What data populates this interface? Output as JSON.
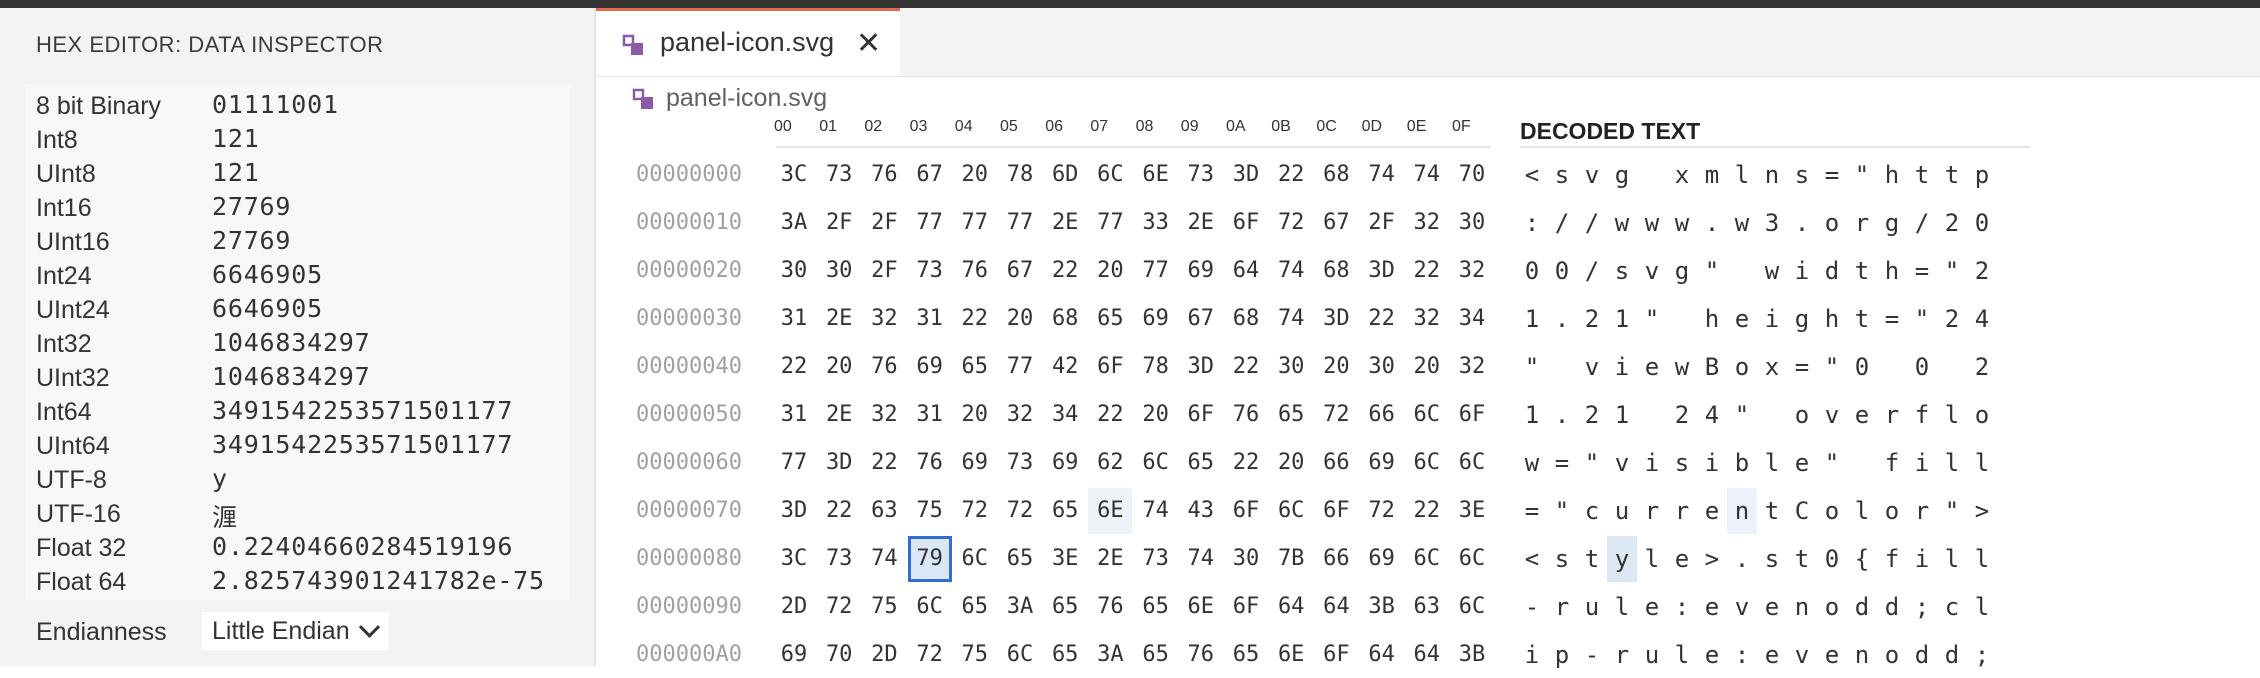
{
  "sidebar": {
    "title": "HEX EDITOR: DATA INSPECTOR",
    "rows": [
      {
        "label": "8 bit Binary",
        "value": "01111001"
      },
      {
        "label": "Int8",
        "value": "121"
      },
      {
        "label": "UInt8",
        "value": "121"
      },
      {
        "label": "Int16",
        "value": "27769"
      },
      {
        "label": "UInt16",
        "value": "27769"
      },
      {
        "label": "Int24",
        "value": "6646905"
      },
      {
        "label": "UInt24",
        "value": "6646905"
      },
      {
        "label": "Int32",
        "value": "1046834297"
      },
      {
        "label": "UInt32",
        "value": "1046834297"
      },
      {
        "label": "Int64",
        "value": "3491542253571501177"
      },
      {
        "label": "UInt64",
        "value": "3491542253571501177"
      },
      {
        "label": "UTF-8",
        "value": "y"
      },
      {
        "label": "UTF-16",
        "value": "湹"
      },
      {
        "label": "Float 32",
        "value": "0.22404660284519196"
      },
      {
        "label": "Float 64",
        "value": "2.825743901241782e-75"
      }
    ],
    "endianness_label": "Endianness",
    "endianness_value": "Little Endian"
  },
  "tab": {
    "label": "panel-icon.svg",
    "close": "✕"
  },
  "breadcrumb": {
    "label": "panel-icon.svg"
  },
  "hex": {
    "header_bytes": [
      "00",
      "01",
      "02",
      "03",
      "04",
      "05",
      "06",
      "07",
      "08",
      "09",
      "0A",
      "0B",
      "0C",
      "0D",
      "0E",
      "0F"
    ],
    "decoded_header": "DECODED TEXT",
    "rows": [
      {
        "offset": "00000000",
        "bytes": [
          "3C",
          "73",
          "76",
          "67",
          "20",
          "78",
          "6D",
          "6C",
          "6E",
          "73",
          "3D",
          "22",
          "68",
          "74",
          "74",
          "70"
        ],
        "text": [
          "<",
          "s",
          "v",
          "g",
          " ",
          "x",
          "m",
          "l",
          "n",
          "s",
          "=",
          "\"",
          "h",
          "t",
          "t",
          "p"
        ]
      },
      {
        "offset": "00000010",
        "bytes": [
          "3A",
          "2F",
          "2F",
          "77",
          "77",
          "77",
          "2E",
          "77",
          "33",
          "2E",
          "6F",
          "72",
          "67",
          "2F",
          "32",
          "30"
        ],
        "text": [
          ":",
          "/",
          "/",
          "w",
          "w",
          "w",
          ".",
          "w",
          "3",
          ".",
          "o",
          "r",
          "g",
          "/",
          "2",
          "0"
        ]
      },
      {
        "offset": "00000020",
        "bytes": [
          "30",
          "30",
          "2F",
          "73",
          "76",
          "67",
          "22",
          "20",
          "77",
          "69",
          "64",
          "74",
          "68",
          "3D",
          "22",
          "32"
        ],
        "text": [
          "0",
          "0",
          "/",
          "s",
          "v",
          "g",
          "\"",
          " ",
          "w",
          "i",
          "d",
          "t",
          "h",
          "=",
          "\"",
          "2"
        ]
      },
      {
        "offset": "00000030",
        "bytes": [
          "31",
          "2E",
          "32",
          "31",
          "22",
          "20",
          "68",
          "65",
          "69",
          "67",
          "68",
          "74",
          "3D",
          "22",
          "32",
          "34"
        ],
        "text": [
          "1",
          ".",
          "2",
          "1",
          "\"",
          " ",
          "h",
          "e",
          "i",
          "g",
          "h",
          "t",
          "=",
          "\"",
          "2",
          "4"
        ]
      },
      {
        "offset": "00000040",
        "bytes": [
          "22",
          "20",
          "76",
          "69",
          "65",
          "77",
          "42",
          "6F",
          "78",
          "3D",
          "22",
          "30",
          "20",
          "30",
          "20",
          "32"
        ],
        "text": [
          "\"",
          " ",
          "v",
          "i",
          "e",
          "w",
          "B",
          "o",
          "x",
          "=",
          "\"",
          "0",
          " ",
          "0",
          " ",
          "2"
        ]
      },
      {
        "offset": "00000050",
        "bytes": [
          "31",
          "2E",
          "32",
          "31",
          "20",
          "32",
          "34",
          "22",
          "20",
          "6F",
          "76",
          "65",
          "72",
          "66",
          "6C",
          "6F"
        ],
        "text": [
          "1",
          ".",
          "2",
          "1",
          " ",
          "2",
          "4",
          "\"",
          " ",
          "o",
          "v",
          "e",
          "r",
          "f",
          "l",
          "o"
        ]
      },
      {
        "offset": "00000060",
        "bytes": [
          "77",
          "3D",
          "22",
          "76",
          "69",
          "73",
          "69",
          "62",
          "6C",
          "65",
          "22",
          "20",
          "66",
          "69",
          "6C",
          "6C"
        ],
        "text": [
          "w",
          "=",
          "\"",
          "v",
          "i",
          "s",
          "i",
          "b",
          "l",
          "e",
          "\"",
          " ",
          "f",
          "i",
          "l",
          "l"
        ]
      },
      {
        "offset": "00000070",
        "bytes": [
          "3D",
          "22",
          "63",
          "75",
          "72",
          "72",
          "65",
          "6E",
          "74",
          "43",
          "6F",
          "6C",
          "6F",
          "72",
          "22",
          "3E"
        ],
        "text": [
          "=",
          "\"",
          "c",
          "u",
          "r",
          "r",
          "e",
          "n",
          "t",
          "C",
          "o",
          "l",
          "o",
          "r",
          "\"",
          ">"
        ]
      },
      {
        "offset": "00000080",
        "bytes": [
          "3C",
          "73",
          "74",
          "79",
          "6C",
          "65",
          "3E",
          "2E",
          "73",
          "74",
          "30",
          "7B",
          "66",
          "69",
          "6C",
          "6C"
        ],
        "text": [
          "<",
          "s",
          "t",
          "y",
          "l",
          "e",
          ">",
          ".",
          "s",
          "t",
          "0",
          "{",
          "f",
          "i",
          "l",
          "l"
        ]
      },
      {
        "offset": "00000090",
        "bytes": [
          "2D",
          "72",
          "75",
          "6C",
          "65",
          "3A",
          "65",
          "76",
          "65",
          "6E",
          "6F",
          "64",
          "64",
          "3B",
          "63",
          "6C"
        ],
        "text": [
          "-",
          "r",
          "u",
          "l",
          "e",
          ":",
          "e",
          "v",
          "e",
          "n",
          "o",
          "d",
          "d",
          ";",
          "c",
          "l"
        ]
      },
      {
        "offset": "000000A0",
        "bytes": [
          "69",
          "70",
          "2D",
          "72",
          "75",
          "6C",
          "65",
          "3A",
          "65",
          "76",
          "65",
          "6E",
          "6F",
          "64",
          "64",
          "3B"
        ],
        "text": [
          "i",
          "p",
          "-",
          "r",
          "u",
          "l",
          "e",
          ":",
          "e",
          "v",
          "e",
          "n",
          "o",
          "d",
          "d",
          ";"
        ]
      }
    ]
  },
  "colors": {
    "accent": "#e06a4c",
    "selection_border": "#2f6fd6",
    "selection_fill": "#dbe7f6",
    "file_icon": "#8c5aa8"
  }
}
